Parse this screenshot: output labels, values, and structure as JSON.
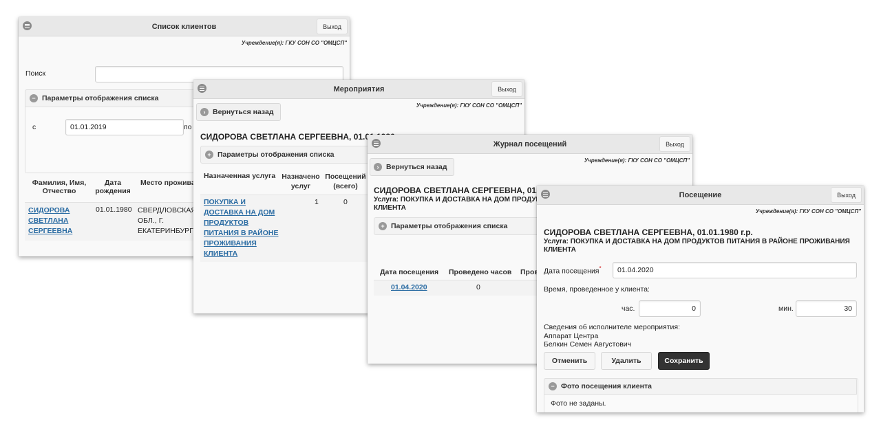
{
  "common": {
    "exit_label": "Выход",
    "institution": "Учреждение(я): ГКУ СОН СО \"ОМЦСП\"",
    "back_label": "Вернуться назад",
    "params_label": "Параметры отображения списка"
  },
  "clients_window": {
    "title": "Список клиентов",
    "search_label": "Поиск",
    "search_value": "",
    "from_label": "с",
    "from_value": "01.01.2019",
    "to_label": "по",
    "columns": [
      "Фамилия, Имя, Отчество",
      "Дата рождения",
      "Место прожива"
    ],
    "row": {
      "name_lines": [
        "СИДОРОВА",
        "СВЕТЛАНА",
        "СЕРГЕЕВНА"
      ],
      "birth": "01.01.1980",
      "place_lines": [
        "СВЕРДЛОВСКАЯ",
        "ОБЛ., Г.",
        "ЕКАТЕРИНБУРГ"
      ]
    }
  },
  "events_window": {
    "title": "Мероприятия",
    "client_heading": "СИДОРОВА СВЕТЛАНА СЕРГЕЕВНА, 01.01.1980 г.р.",
    "columns": [
      "Назначенная услуга",
      "Назначено услуг",
      "Посещений (всего)"
    ],
    "row": {
      "service_lines": [
        "ПОКУПКА И",
        "ДОСТАВКА НА ДОМ",
        "ПРОДУКТОВ",
        "ПИТАНИЯ В РАЙОНЕ",
        "ПРОЖИВАНИЯ",
        "КЛИЕНТА"
      ],
      "assigned": "1",
      "visits": "0"
    }
  },
  "journal_window": {
    "title": "Журнал посещений",
    "client_heading": "СИДОРОВА СВЕТЛАНА СЕРГЕЕВНА, 01.0",
    "service_line1": "Услуга: ПОКУПКА И ДОСТАВКА НА ДОМ ПРОДУК",
    "service_line2": "КЛИЕНТА",
    "columns": [
      "Дата посещения",
      "Проведено часов",
      "Пров"
    ],
    "row": {
      "date": "01.04.2020",
      "hours": "0"
    }
  },
  "visit_window": {
    "title": "Посещение",
    "client_heading": "СИДОРОВА СВЕТЛАНА СЕРГЕЕВНА, 01.01.1980 г.р.",
    "service_line1": "Услуга: ПОКУПКА И ДОСТАВКА НА ДОМ ПРОДУКТОВ ПИТАНИЯ В РАЙОНЕ ПРОЖИВАНИЯ",
    "service_line2": "КЛИЕНТА",
    "date_label": "Дата посещения",
    "required_mark": "*",
    "date_value": "01.04.2020",
    "time_label": "Время, проведенное у клиента:",
    "hours_label": "час.",
    "hours_value": "0",
    "minutes_label": "мин.",
    "minutes_value": "30",
    "executor_label": "Сведения об исполнителе мероприятия:",
    "executor_org": "Аппарат Центра",
    "executor_name": "Белкин Семен Августович",
    "cancel_label": "Отменить",
    "delete_label": "Удалить",
    "save_label": "Сохранить",
    "photo_section": "Фото посещения клиента",
    "photo_empty": "Фото не заданы."
  },
  "icons": {
    "menu": "menu-circle-icon",
    "back": "arrow-left-circle-icon",
    "collapse": "minus-circle-icon",
    "expand": "plus-circle-icon"
  }
}
